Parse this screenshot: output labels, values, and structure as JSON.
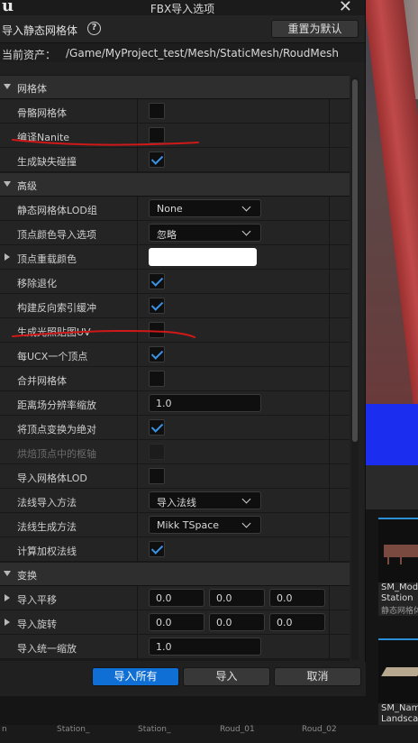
{
  "dialog": {
    "title": "FBX导入选项",
    "close_glyph": "✕",
    "logo": "u",
    "header_title": "导入静态网格体",
    "help_glyph": "?",
    "reset_button": "重置为默认",
    "asset_label": "当前资产：",
    "asset_path": "/Game/MyProject_test/Mesh/StaticMesh/RoudMesh"
  },
  "sections": {
    "mesh": "网格体",
    "advanced": "高级",
    "transform": "变换"
  },
  "mesh_rows": [
    {
      "label": "骨骼网格体",
      "checked": false
    },
    {
      "label": "编译Nanite",
      "checked": false
    },
    {
      "label": "生成缺失碰撞",
      "checked": true
    }
  ],
  "advanced_rows": {
    "lod_group": {
      "label": "静态网格体LOD组",
      "value": "None"
    },
    "vertex_color_import": {
      "label": "顶点颜色导入选项",
      "value": "忽略"
    },
    "vertex_override_color": {
      "label": "顶点重载颜色",
      "color": "#ffffff"
    },
    "remove_degenerates": {
      "label": "移除退化",
      "checked": true
    },
    "build_reversed_index": {
      "label": "构建反向索引缓冲",
      "checked": true
    },
    "generate_lightmap_uv": {
      "label": "生成光照贴图UV",
      "checked": false
    },
    "one_convex_per_ucx": {
      "label": "每UCX一个顶点",
      "checked": true
    },
    "combine_meshes": {
      "label": "合并网格体",
      "checked": false
    },
    "distance_field_scale": {
      "label": "距离场分辨率缩放",
      "value": "1.0"
    },
    "transform_vertex_abs": {
      "label": "将顶点变换为绝对",
      "checked": true
    },
    "bake_pivot": {
      "label": "烘焙顶点中的枢轴",
      "checked": false,
      "disabled": true
    },
    "import_mesh_lods": {
      "label": "导入网格体LOD",
      "checked": false
    },
    "normal_import_method": {
      "label": "法线导入方法",
      "value": "导入法线"
    },
    "normal_generation_method": {
      "label": "法线生成方法",
      "value": "Mikk TSpace"
    },
    "compute_weighted_normals": {
      "label": "计算加权法线",
      "checked": true
    }
  },
  "transform_rows": {
    "translation": {
      "label": "导入平移",
      "x": "0.0",
      "y": "0.0",
      "z": "0.0"
    },
    "rotation": {
      "label": "导入旋转",
      "x": "0.0",
      "y": "0.0",
      "z": "0.0"
    },
    "uniform_scale": {
      "label": "导入统一缩放",
      "value": "1.0"
    }
  },
  "footer": {
    "import_all": "导入所有",
    "import": "导入",
    "cancel": "取消"
  },
  "content_browser": {
    "tile1_name": "SM_Mod",
    "tile1_name2": "Station",
    "tile1_type": "静态网格体",
    "tile2_name": "SM_Nam",
    "tile2_name2": "Landsca",
    "bottom": [
      "n",
      "Station_",
      "Station_",
      "Roud_01",
      "Roud_02"
    ]
  },
  "colors": {
    "accent_blue": "#0f6fd4",
    "checkmark": "#3a93e6",
    "annotation_red": "#d01818"
  }
}
